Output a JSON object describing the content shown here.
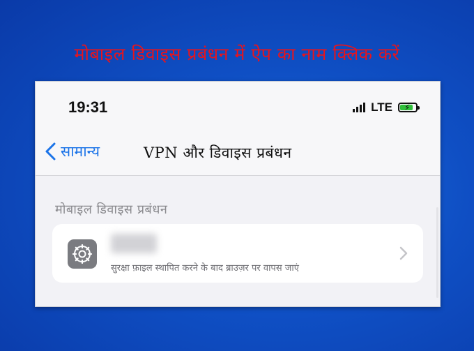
{
  "banner": {
    "text": "मोबाइल डिवाइस प्रबंधन में ऐप का नाम क्लिक करें"
  },
  "status_bar": {
    "time": "19:31",
    "network": "LTE",
    "battery_level": 0.8,
    "charging": true
  },
  "nav": {
    "back_label": "सामान्य",
    "title": "VPN और डिवाइस प्रबंधन"
  },
  "section": {
    "header": "मोबाइल डिवाइस प्रबंधन"
  },
  "profile_row": {
    "app_name": "",
    "subtitle": "सुरक्षा फ़ाइल स्थापित करने के बाद ब्राउज़र पर वापस जाएं",
    "icon": "settings-gear-icon"
  },
  "colors": {
    "banner_text": "#e8141c",
    "link_blue": "#1a73e8",
    "background_blue": "#0f4fc4"
  }
}
